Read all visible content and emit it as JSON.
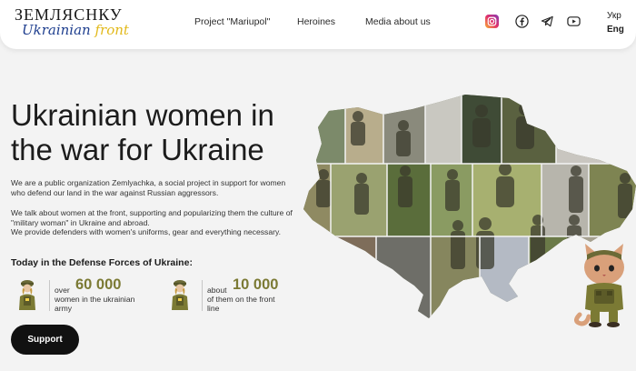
{
  "header": {
    "logo": {
      "top": "ЗЕМЛЯСНКУ",
      "bottom_pre": "Ukrainian ",
      "bottom_accent": "front"
    },
    "nav": [
      {
        "label": "Project \"Mariupol\""
      },
      {
        "label": "Heroines"
      },
      {
        "label": "Media about us"
      }
    ],
    "social": [
      "instagram-icon",
      "facebook-icon",
      "telegram-icon",
      "youtube-icon"
    ],
    "lang": {
      "ukr": "Укр",
      "eng": "Eng"
    }
  },
  "hero": {
    "title": "Ukrainian women in the war for Ukraine",
    "p1": "We are a public organization Zemlyachka, a social project in support for women who defend our land in the war against Russian aggressors.",
    "p2": "We talk about women at the front, supporting and popularizing them the culture of \"military woman\" in Ukraine and abroad.",
    "p3": "We provide defenders with women's uniforms, gear and everything necessary.",
    "subhead": "Today in the Defense Forces of Ukraine:",
    "stats": [
      {
        "pre": "over",
        "number": "60 000",
        "desc1": "women in the ukrainian",
        "desc2": "army"
      },
      {
        "pre": "about",
        "number": "10 000",
        "desc1": "of them on the front",
        "desc2": "line"
      }
    ],
    "support_label": "Support"
  },
  "colors": {
    "accent_olive": "#7b7a34",
    "logo_blue": "#1f3f8f",
    "logo_yellow": "#e2b91a"
  }
}
